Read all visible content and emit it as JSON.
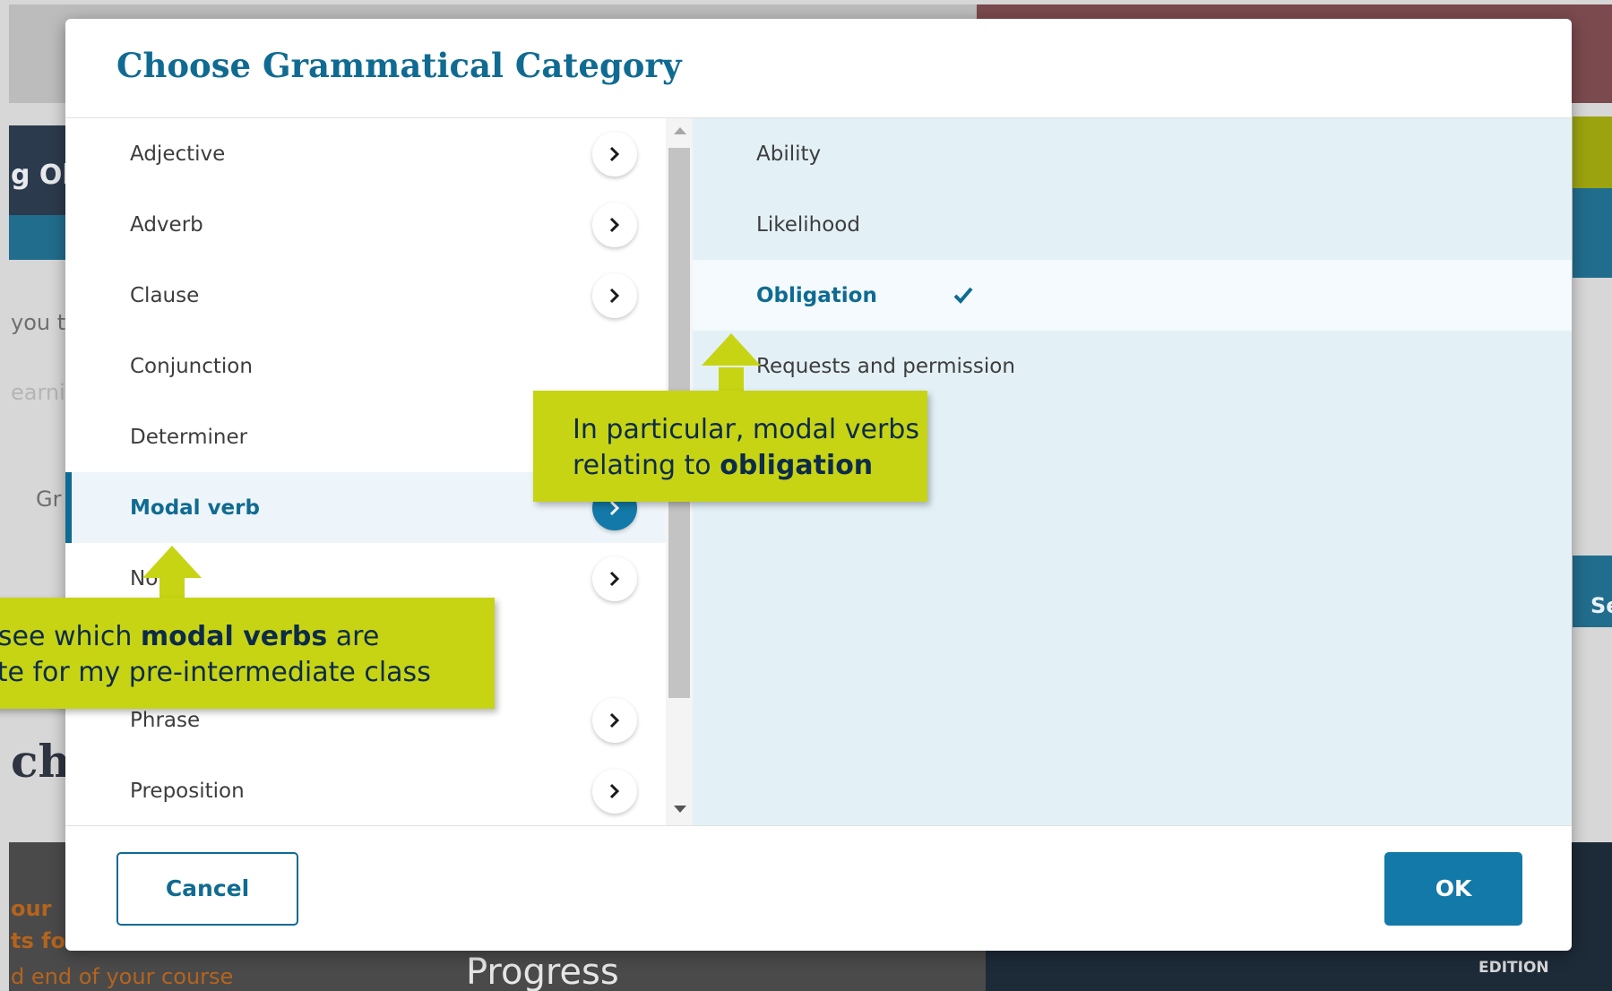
{
  "background": {
    "fragments": [
      "g Ob",
      "you te",
      "earni",
      "Gr",
      "ch",
      "our",
      "ts fo",
      "d end of your course",
      "Progress",
      "EDITION",
      "Se"
    ]
  },
  "dialog": {
    "title": "Choose Grammatical Category",
    "categories": [
      {
        "label": "Adjective",
        "selected": false,
        "has_children": true
      },
      {
        "label": "Adverb",
        "selected": false,
        "has_children": true
      },
      {
        "label": "Clause",
        "selected": false,
        "has_children": true
      },
      {
        "label": "Conjunction",
        "selected": false,
        "has_children": false
      },
      {
        "label": "Determiner",
        "selected": false,
        "has_children": false
      },
      {
        "label": "Modal verb",
        "selected": true,
        "has_children": true
      },
      {
        "label": "No",
        "selected": false,
        "has_children": true
      },
      {
        "label": "Phrase",
        "selected": false,
        "has_children": true
      },
      {
        "label": "Preposition",
        "selected": false,
        "has_children": true
      }
    ],
    "subcategories": [
      {
        "label": "Ability",
        "selected": false
      },
      {
        "label": "Likelihood",
        "selected": false
      },
      {
        "label": "Obligation",
        "selected": true
      },
      {
        "label": "Requests and permission",
        "selected": false
      }
    ],
    "cancel_label": "Cancel",
    "ok_label": "OK"
  },
  "callouts": {
    "first": {
      "line1_pre": "o see which ",
      "line1_bold": "modal verbs",
      "line1_post": " are",
      "line2": "iate for my pre-intermediate class"
    },
    "second": {
      "line1": "In particular, modal verbs",
      "line2_pre": "relating to ",
      "line2_bold": "obligation"
    }
  },
  "colors": {
    "brand_blue": "#0f6b92",
    "button_blue": "#1379a8",
    "callout_yellow": "#c7d414",
    "panel_tint": "#e3f1f7"
  },
  "icons": {
    "chevron": "chevron-right-icon",
    "check": "check-icon"
  }
}
